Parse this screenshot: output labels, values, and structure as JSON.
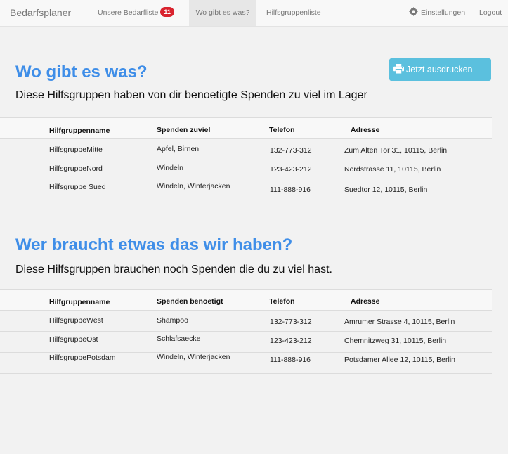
{
  "navbar": {
    "brand": "Bedarfsplaner",
    "items": [
      {
        "label": "Unsere Bedarfliste",
        "badge": "11"
      },
      {
        "label": "Wo gibt es was?"
      },
      {
        "label": "Hilfsgruppenliste"
      }
    ],
    "settings_label": "Einstellungen",
    "logout_label": "Logout"
  },
  "print_button": {
    "label": "Jetzt ausdrucken"
  },
  "surplus_section": {
    "title": "Wo gibt es was?",
    "subtitle": "Diese Hilfsgruppen haben von dir benoetigte Spenden zu viel im Lager",
    "headers": [
      "Hilfgruppenname",
      "Spenden zuviel",
      "Telefon",
      "Adresse"
    ],
    "rows": [
      [
        "HilfsgruppeMitte",
        "Apfel, Birnen",
        "132-773-312",
        "Zum Alten Tor 31, 10115, Berlin"
      ],
      [
        "HilfsgruppeNord",
        "Windeln",
        "123-423-212",
        "Nordstrasse 11, 10115, Berlin"
      ],
      [
        "Hilfsgruppe Sued",
        "Windeln, Winterjacken",
        "111-888-916",
        "Suedtor 12, 10115, Berlin"
      ]
    ]
  },
  "needs_section": {
    "title": "Wer braucht etwas das wir haben?",
    "subtitle": "Diese Hilfsgruppen brauchen noch Spenden die du zu viel hast.",
    "headers": [
      "Hilfgruppenname",
      "Spenden benoetigt",
      "Telefon",
      "Adresse"
    ],
    "rows": [
      [
        "HilfsgruppeWest",
        "Shampoo",
        "132-773-312",
        "Amrumer Strasse 4, 10115, Berlin"
      ],
      [
        "HilfsgruppeOst",
        "Schlafsaecke",
        "123-423-212",
        "Chemnitzweg 31, 10115, Berlin"
      ],
      [
        "HilfsgruppePotsdam",
        "Windeln, Winterjacken",
        "111-888-916",
        "Potsdamer Allee 12, 10115, Berlin"
      ]
    ]
  },
  "colors": {
    "accent": "#3f8ee8",
    "button": "#5bc0de",
    "badge": "#d9232e"
  },
  "icons": {
    "settings": "gear-icon",
    "print": "printer-icon"
  }
}
